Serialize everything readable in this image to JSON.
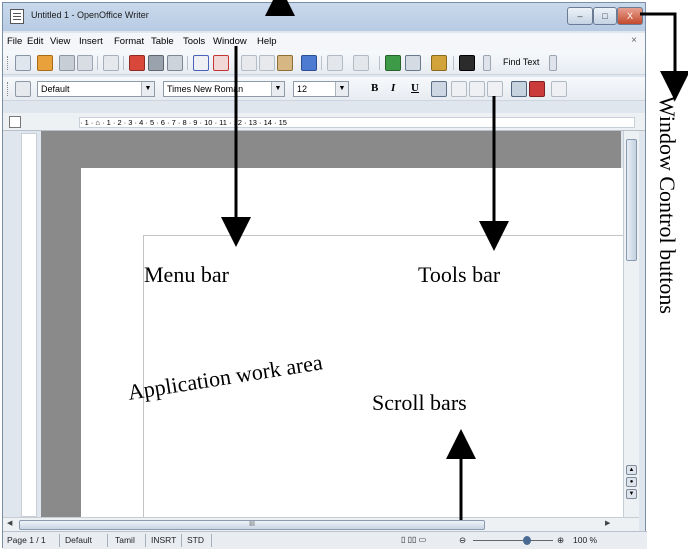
{
  "window": {
    "title": "Untitled 1 - OpenOffice Writer",
    "controls": [
      "–",
      "□",
      "X"
    ]
  },
  "menubar": {
    "items": [
      "File",
      "Edit",
      "View",
      "Insert",
      "Format",
      "Table",
      "Tools",
      "Window",
      "Help"
    ],
    "close": "×"
  },
  "toolbar": {
    "find_text": "Find Text"
  },
  "formatting": {
    "style": "Default",
    "font": "Times New Roman",
    "size": "12",
    "bold": "B",
    "italic": "I",
    "underline": "U"
  },
  "ruler": {
    "labels": "· 1 · ⌂ · 1 · 2 · 3 · 4 · 5 · 6 · 7 · 8 · 9 · 10 · 11 · 12 · 13 · 14 · 15"
  },
  "hscroll": {
    "thumb_label": "III"
  },
  "statusbar": {
    "page": "Page 1 / 1",
    "style": "Default",
    "language": "Tamil",
    "mode": "INSRT",
    "selection": "STD",
    "zoom": "100 %"
  },
  "annotations": {
    "menu_bar": "Menu bar",
    "tools_bar": "Tools bar",
    "work_area": "Application work area",
    "scroll_bars": "Scroll bars",
    "window_controls": "Window Control buttons"
  }
}
